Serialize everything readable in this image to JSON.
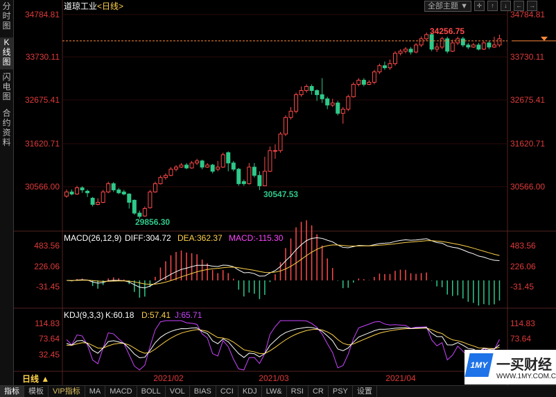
{
  "sidebar": {
    "tabs": [
      {
        "id": "timeshare",
        "label": "分时图"
      },
      {
        "id": "kline",
        "label": "K线图"
      },
      {
        "id": "flash",
        "label": "闪电图"
      },
      {
        "id": "contract",
        "label": "合约资料"
      }
    ]
  },
  "header": {
    "instrument": "道琼工业",
    "period_tag": "<日线>",
    "theme_button": "全部主题",
    "theme_arrow": "▼"
  },
  "price_panel": {
    "axis_labels": [
      "34784.81",
      "33730.11",
      "32675.41",
      "31620.71",
      "30566.00"
    ],
    "high_label": "34256.75",
    "low_label_1": "29856.30",
    "low_label_2": "30547.53"
  },
  "macd_panel": {
    "title": "MACD(26,12,9)",
    "diff": "DIFF:304.72",
    "dea": "DEA:362.37",
    "macd": "MACD:-115.30",
    "axis_labels": [
      "483.56",
      "226.06",
      "-31.45"
    ]
  },
  "kdj_panel": {
    "title": "KDJ(9,3,3)",
    "k": "K:60.18",
    "d": "D:57.41",
    "j": "J:65.71",
    "axis_labels": [
      "114.83",
      "73.64",
      "32.45"
    ]
  },
  "time_axis": [
    "2021/02",
    "2021/03",
    "2021/04"
  ],
  "period_selector": "日线 ▲",
  "bottom_tabs": [
    "指标",
    "模板",
    "VIP指标",
    "MA",
    "MACD",
    "BOLL",
    "VOL",
    "BIAS",
    "CCI",
    "KDJ",
    "LW&",
    "RSI",
    "CR",
    "PSY",
    "设置"
  ],
  "logo": {
    "mark": "1MY",
    "name": "一买财经",
    "url": "WWW.1MY.COM.CN"
  },
  "colors": {
    "up": "#ff4a4a",
    "down": "#2ec98a",
    "diff": "#ffffff",
    "dea": "#ffd24a",
    "macd": "#ff44ff",
    "k": "#ffffff",
    "d": "#ffd24a",
    "j": "#cc44ff",
    "grid": "#551111",
    "axis_text": "#e03a3a"
  },
  "chart_data": {
    "type": "candlestick",
    "x_range": [
      "2021-01",
      "2021-04"
    ],
    "y_range": [
      29856.3,
      34784.81
    ],
    "candles": [
      [
        30400,
        30500,
        30360,
        30560
      ],
      [
        30500,
        30450,
        30420,
        30560
      ],
      [
        30450,
        30600,
        30430,
        30650
      ],
      [
        30600,
        30550,
        30480,
        30640
      ],
      [
        30520,
        30480,
        30380,
        30560
      ],
      [
        30350,
        30200,
        30150,
        30380
      ],
      [
        30200,
        30250,
        30180,
        30350
      ],
      [
        30250,
        30500,
        30230,
        30550
      ],
      [
        30500,
        30700,
        30470,
        30750
      ],
      [
        30700,
        30550,
        30500,
        30740
      ],
      [
        30550,
        30480,
        30450,
        30600
      ],
      [
        30500,
        30450,
        30420,
        30550
      ],
      [
        30450,
        30250,
        30100,
        30470
      ],
      [
        30300,
        29990,
        29950,
        30320
      ],
      [
        29990,
        29910,
        29856,
        30050
      ],
      [
        29920,
        30100,
        29900,
        30150
      ],
      [
        30120,
        30500,
        30100,
        30550
      ],
      [
        30500,
        30700,
        30480,
        30750
      ],
      [
        30700,
        30850,
        30680,
        30900
      ],
      [
        30850,
        30900,
        30800,
        30950
      ],
      [
        30900,
        31050,
        30880,
        31100
      ],
      [
        31050,
        31100,
        31000,
        31150
      ],
      [
        31100,
        31150,
        31080,
        31200
      ],
      [
        31150,
        31080,
        31050,
        31200
      ],
      [
        31080,
        31200,
        31060,
        31250
      ],
      [
        31200,
        31250,
        31150,
        31300
      ],
      [
        31250,
        31100,
        31050,
        31280
      ],
      [
        31100,
        31150,
        31080,
        31200
      ],
      [
        31150,
        31000,
        30950,
        31180
      ],
      [
        31050,
        31100,
        31000,
        31250
      ],
      [
        31100,
        31400,
        31080,
        31450
      ],
      [
        31450,
        31200,
        31000,
        31480
      ],
      [
        31200,
        31050,
        31000,
        31250
      ],
      [
        31050,
        30700,
        30650,
        31080
      ],
      [
        30750,
        30700,
        30650,
        30800
      ],
      [
        30700,
        31100,
        30680,
        31200
      ],
      [
        31100,
        30900,
        30850,
        31200
      ],
      [
        30900,
        30650,
        30547,
        31000
      ],
      [
        30650,
        31000,
        30640,
        31350
      ],
      [
        31000,
        31500,
        30980,
        31600
      ],
      [
        31500,
        31500,
        31300,
        31650
      ],
      [
        31500,
        31900,
        31450,
        31950
      ],
      [
        31900,
        32300,
        31850,
        32350
      ],
      [
        32300,
        32450,
        32250,
        32550
      ],
      [
        32450,
        32850,
        32400,
        32900
      ],
      [
        32850,
        32950,
        32800,
        33050
      ],
      [
        32950,
        33050,
        32900,
        33100
      ],
      [
        33050,
        32950,
        32850,
        33100
      ],
      [
        32950,
        32850,
        32700,
        32980
      ],
      [
        32850,
        32750,
        32650,
        33250
      ],
      [
        32750,
        32600,
        32500,
        32800
      ],
      [
        32600,
        32650,
        32550,
        32750
      ],
      [
        32650,
        32400,
        32350,
        32700
      ],
      [
        32400,
        32500,
        32150,
        32550
      ],
      [
        32500,
        32800,
        32450,
        32850
      ],
      [
        32800,
        33100,
        32780,
        33150
      ],
      [
        33100,
        33200,
        33050,
        33250
      ],
      [
        33200,
        33100,
        33050,
        33250
      ],
      [
        33100,
        33150,
        33080,
        33200
      ],
      [
        33150,
        33400,
        33100,
        33450
      ],
      [
        33400,
        33550,
        33350,
        33600
      ],
      [
        33550,
        33500,
        33450,
        33650
      ],
      [
        33500,
        33600,
        33450,
        33700
      ],
      [
        33600,
        33850,
        33550,
        33900
      ],
      [
        33850,
        33900,
        33800,
        33950
      ],
      [
        33900,
        33950,
        33850,
        34000
      ],
      [
        33950,
        33880,
        33820,
        34000
      ],
      [
        33880,
        34050,
        33850,
        34100
      ],
      [
        34050,
        34200,
        34000,
        34256
      ],
      [
        34200,
        34300,
        34150,
        34350
      ],
      [
        34300,
        33950,
        33900,
        34350
      ],
      [
        33950,
        34000,
        33880,
        34100
      ],
      [
        34000,
        34200,
        33950,
        34250
      ],
      [
        34200,
        33900,
        33850,
        34250
      ],
      [
        33900,
        34100,
        33880,
        34180
      ],
      [
        34100,
        34200,
        34050,
        34250
      ],
      [
        34200,
        34050,
        34000,
        34250
      ],
      [
        34050,
        34000,
        33950,
        34100
      ],
      [
        34000,
        34050,
        33980,
        34100
      ],
      [
        34050,
        33950,
        33920,
        34100
      ],
      [
        33950,
        34100,
        33930,
        34150
      ],
      [
        34100,
        34000,
        33950,
        34150
      ],
      [
        34000,
        34050,
        33980,
        34250
      ],
      [
        34050,
        34200,
        34000,
        34300
      ]
    ],
    "current_price_line": 34150
  }
}
